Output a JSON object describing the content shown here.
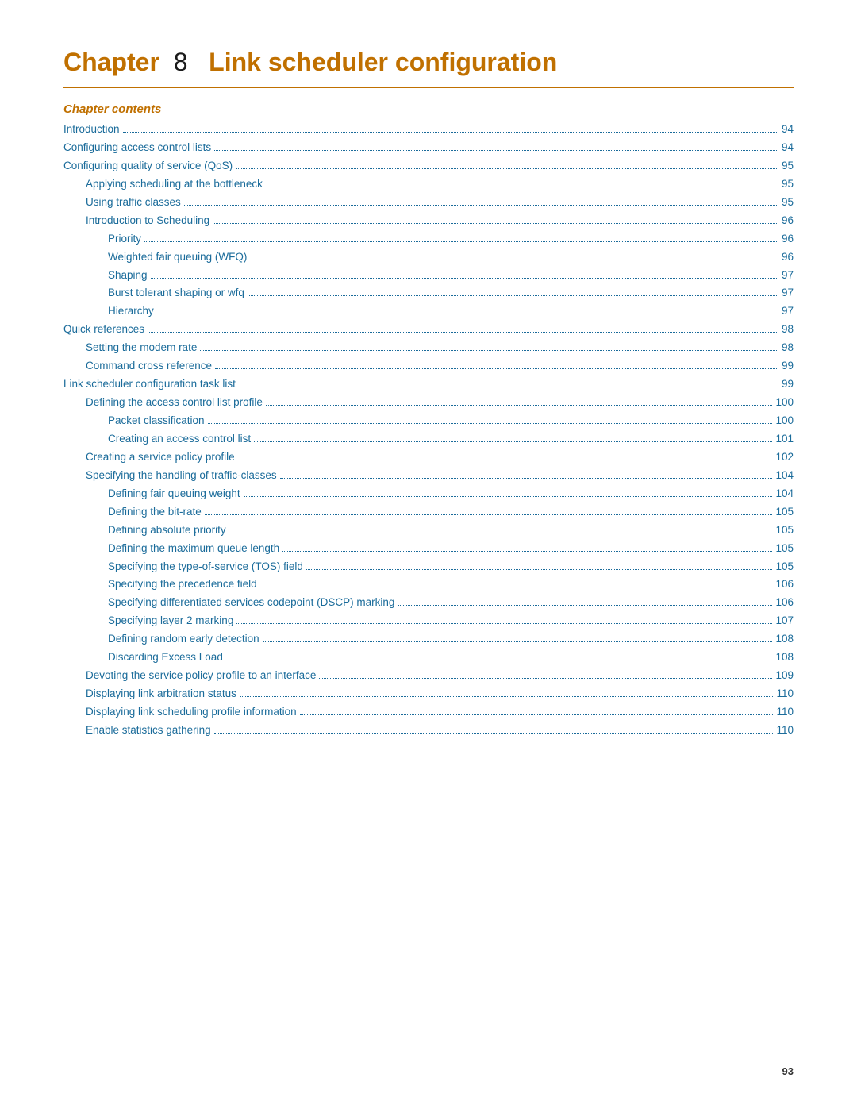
{
  "header": {
    "chapter_num": "Chapter 8",
    "chapter_title": "Link scheduler configuration",
    "chapter_label": "Chapter",
    "divider_color": "#c07000"
  },
  "contents": {
    "label": "Chapter contents",
    "items": [
      {
        "text": "Introduction",
        "page": "94",
        "indent": 0
      },
      {
        "text": "Configuring access control lists",
        "page": "94",
        "indent": 0
      },
      {
        "text": "Configuring quality of service (QoS)",
        "page": "95",
        "indent": 0
      },
      {
        "text": "Applying scheduling at the bottleneck",
        "page": "95",
        "indent": 1
      },
      {
        "text": "Using traffic classes",
        "page": "95",
        "indent": 1
      },
      {
        "text": "Introduction to Scheduling",
        "page": "96",
        "indent": 1
      },
      {
        "text": "Priority",
        "page": "96",
        "indent": 2
      },
      {
        "text": "Weighted fair queuing (WFQ)",
        "page": "96",
        "indent": 2
      },
      {
        "text": "Shaping",
        "page": "97",
        "indent": 2
      },
      {
        "text": "Burst tolerant shaping or wfq",
        "page": "97",
        "indent": 2
      },
      {
        "text": "Hierarchy",
        "page": "97",
        "indent": 2
      },
      {
        "text": "Quick references",
        "page": "98",
        "indent": 0
      },
      {
        "text": "Setting the modem rate",
        "page": "98",
        "indent": 1
      },
      {
        "text": "Command cross reference",
        "page": "99",
        "indent": 1
      },
      {
        "text": "Link scheduler configuration task list",
        "page": "99",
        "indent": 0
      },
      {
        "text": "Defining the access control list profile",
        "page": "100",
        "indent": 1
      },
      {
        "text": "Packet classification",
        "page": "100",
        "indent": 2
      },
      {
        "text": "Creating an access control list",
        "page": "101",
        "indent": 2
      },
      {
        "text": "Creating a service policy profile",
        "page": "102",
        "indent": 1
      },
      {
        "text": "Specifying the handling of traffic-classes",
        "page": "104",
        "indent": 1
      },
      {
        "text": "Defining fair queuing weight",
        "page": "104",
        "indent": 2
      },
      {
        "text": "Defining the bit-rate",
        "page": "105",
        "indent": 2
      },
      {
        "text": "Defining absolute priority",
        "page": "105",
        "indent": 2
      },
      {
        "text": "Defining the maximum queue length",
        "page": "105",
        "indent": 2
      },
      {
        "text": "Specifying the type-of-service (TOS) field",
        "page": "105",
        "indent": 2
      },
      {
        "text": "Specifying the precedence field",
        "page": "106",
        "indent": 2
      },
      {
        "text": "Specifying differentiated services codepoint (DSCP) marking",
        "page": "106",
        "indent": 2
      },
      {
        "text": "Specifying layer 2 marking",
        "page": "107",
        "indent": 2
      },
      {
        "text": "Defining random early detection",
        "page": "108",
        "indent": 2
      },
      {
        "text": "Discarding Excess Load",
        "page": "108",
        "indent": 2
      },
      {
        "text": "Devoting the service policy profile to an interface",
        "page": "109",
        "indent": 1
      },
      {
        "text": "Displaying link arbitration status",
        "page": "110",
        "indent": 1
      },
      {
        "text": "Displaying link scheduling profile information",
        "page": "110",
        "indent": 1
      },
      {
        "text": "Enable statistics gathering",
        "page": "110",
        "indent": 1
      }
    ]
  },
  "page_number": "93"
}
